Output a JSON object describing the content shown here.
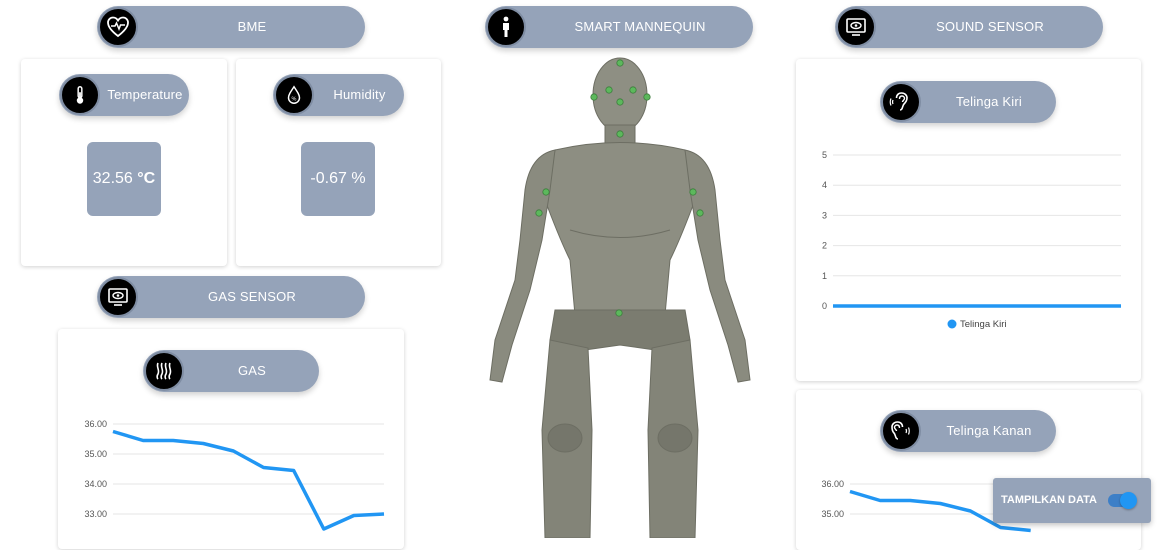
{
  "bme": {
    "title": "BME"
  },
  "temperature": {
    "label": "Temperature",
    "value": "32.56",
    "unit": "°C"
  },
  "humidity": {
    "label": "Humidity",
    "value": "-0.67 %"
  },
  "gas_sensor": {
    "title": "GAS SENSOR"
  },
  "gas": {
    "label": "GAS"
  },
  "mannequin": {
    "title": "SMART MANNEQUIN"
  },
  "sound_sensor": {
    "title": "SOUND SENSOR"
  },
  "left_ear": {
    "label": "Telinga Kiri"
  },
  "right_ear": {
    "label": "Telinga Kanan"
  },
  "toggle": {
    "label": "TAMPILKAN DATA",
    "on": true
  },
  "colors": {
    "accent": "#95a3b9",
    "line": "#2196f3",
    "sensor_dot": "#5cb85c"
  },
  "chart_data": [
    {
      "type": "line",
      "id": "gas",
      "y_ticks": [
        "33.00",
        "34.00",
        "35.00",
        "36.00"
      ],
      "series": [
        {
          "values": [
            35.75,
            35.45,
            35.45,
            35.35,
            35.1,
            34.55,
            34.45,
            32.5,
            32.95,
            33.0
          ]
        }
      ],
      "grid": true
    },
    {
      "type": "line",
      "id": "telinga-kiri",
      "y_ticks": [
        "0",
        "1",
        "2",
        "3",
        "4",
        "5"
      ],
      "series": [
        {
          "name": "Telinga Kiri",
          "values": [
            0,
            0,
            0,
            0,
            0,
            0,
            0,
            0,
            0,
            0
          ]
        }
      ],
      "legend": "bottom",
      "grid": true
    },
    {
      "type": "line",
      "id": "telinga-kanan",
      "y_ticks": [
        "35.00",
        "36.00"
      ],
      "series": [
        {
          "values": [
            35.75,
            35.45,
            35.45,
            35.35,
            35.1,
            34.55,
            34.45
          ]
        }
      ],
      "grid": true
    }
  ]
}
